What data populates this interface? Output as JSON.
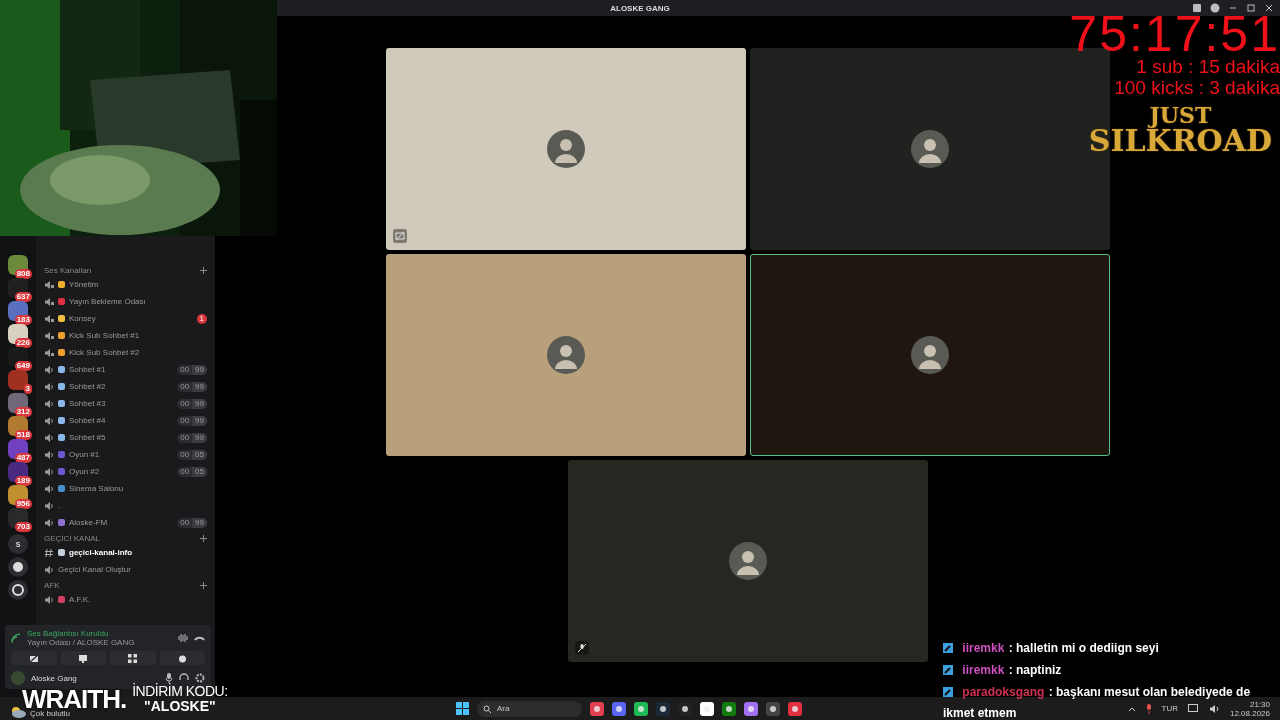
{
  "window": {
    "title": "ALOSKE GANG"
  },
  "servers": [
    {
      "badge": "808",
      "color": "#6b8a3a"
    },
    {
      "badge": "637",
      "color": "#202020"
    },
    {
      "badge": "183",
      "color": "#5a6fc0"
    },
    {
      "badge": "226",
      "color": "#d8d0c0"
    },
    {
      "badge": "649",
      "color": "#1a1a1a"
    },
    {
      "badge": "3",
      "color": "#a03020"
    },
    {
      "badge": "312",
      "color": "#706878"
    },
    {
      "badge": "518",
      "color": "#b07a30"
    },
    {
      "badge": "487",
      "color": "#7040c0"
    },
    {
      "badge": "189",
      "color": "#4a2a80"
    },
    {
      "badge": "956",
      "color": "#c09030"
    },
    {
      "badge": "703",
      "color": "#2a2a2a"
    }
  ],
  "server_letter": "S",
  "sections": [
    {
      "title": "Ses Kanalları",
      "channels": [
        {
          "kind": "voice",
          "name": "Yönetim",
          "locked": true,
          "color": "#f0b030"
        },
        {
          "kind": "voice",
          "name": "Yayın Bekleme Odası",
          "locked": true,
          "color": "#e03040"
        },
        {
          "kind": "voice",
          "name": "Konsey",
          "locked": true,
          "color": "#f0c040",
          "badge": "1"
        },
        {
          "kind": "voice",
          "name": "Kick Sub Sohbet #1",
          "locked": true,
          "color": "#f0a030"
        },
        {
          "kind": "voice",
          "name": "Kick Sub Sohbet #2",
          "locked": true,
          "color": "#f0a030"
        },
        {
          "kind": "voice",
          "name": "Sohbet #1",
          "locked": false,
          "color": "#8ab8e8",
          "count": "00",
          "limit": "99"
        },
        {
          "kind": "voice",
          "name": "Sohbet #2",
          "locked": false,
          "color": "#8ab8e8",
          "count": "00",
          "limit": "99"
        },
        {
          "kind": "voice",
          "name": "Sohbet #3",
          "locked": false,
          "color": "#8ab8e8",
          "count": "00",
          "limit": "99"
        },
        {
          "kind": "voice",
          "name": "Sohbet #4",
          "locked": false,
          "color": "#8ab8e8",
          "count": "00",
          "limit": "99"
        },
        {
          "kind": "voice",
          "name": "Sohbet #5",
          "locked": false,
          "color": "#8ab8e8",
          "count": "00",
          "limit": "99"
        },
        {
          "kind": "voice",
          "name": "Oyun #1",
          "locked": false,
          "color": "#6a5ad0",
          "count": "00",
          "limit": "05"
        },
        {
          "kind": "voice",
          "name": "Oyun #2",
          "locked": false,
          "color": "#6a5ad0",
          "count": "00",
          "limit": "05"
        },
        {
          "kind": "voice",
          "name": "Sinema Salonu",
          "locked": false,
          "color": "#4a90d0"
        },
        {
          "kind": "voice",
          "name": ".",
          "locked": false
        },
        {
          "kind": "voice",
          "name": "Aloske-FM",
          "locked": false,
          "color": "#9070d0",
          "count": "00",
          "limit": "99"
        }
      ]
    },
    {
      "title": "GEÇİCİ KANAL",
      "channels": [
        {
          "kind": "text",
          "name": "geçici-kanal-info",
          "selected": true,
          "color": "#c8d0e0"
        },
        {
          "kind": "create",
          "name": "Geçici Kanal Oluştur"
        }
      ]
    },
    {
      "title": "AFK",
      "channels": [
        {
          "kind": "voice",
          "name": "A.F.K.",
          "locked": false,
          "color": "#d04060"
        }
      ]
    }
  ],
  "voice_panel": {
    "status": "Ses Bağlantısı Kuruldu",
    "location": "Yayın Odası / ALOSKE GANG"
  },
  "user": {
    "name": "Aloske Gang"
  },
  "tiles": [
    {
      "kind": "stream",
      "color": "#cfcabc",
      "speaking": false,
      "muted": false
    },
    {
      "kind": "user",
      "color": "#1f221e",
      "speaking": false,
      "muted": false
    },
    {
      "kind": "user",
      "color": "#b8a07a",
      "speaking": false,
      "muted": false
    },
    {
      "kind": "user",
      "color": "#1f160f",
      "speaking": true,
      "muted": false
    },
    {
      "kind": "user",
      "color": "#262720",
      "speaking": false,
      "muted": true
    }
  ],
  "timer": {
    "time": "75:17:51",
    "rules": [
      "1 sub : 15 dakika",
      "100 kicks : 3 dakika"
    ]
  },
  "logo": {
    "top": "JUST",
    "bottom": "SILKROAD"
  },
  "chat": [
    {
      "user": "iiremkk",
      "color": "#d050c0",
      "text": ": halletin mi o dediign seyi"
    },
    {
      "user": "iiremkk",
      "color": "#d050c0",
      "text": ": naptiniz"
    },
    {
      "user": "paradoksgang",
      "color": "#d03050",
      "text": ": başkanı mesut olan belediyede de",
      "continuation": "ikmet etmem"
    }
  ],
  "sponsor": {
    "brand": "WRAITH.",
    "label": "İNDİRİM KODU:",
    "code": "\"ALOSKE\""
  },
  "weather": {
    "text": "Çok bulutlu"
  },
  "taskbar": {
    "placeholder": "Ara",
    "language": "TUR",
    "time": "21:30",
    "date": "12.08.2026"
  }
}
